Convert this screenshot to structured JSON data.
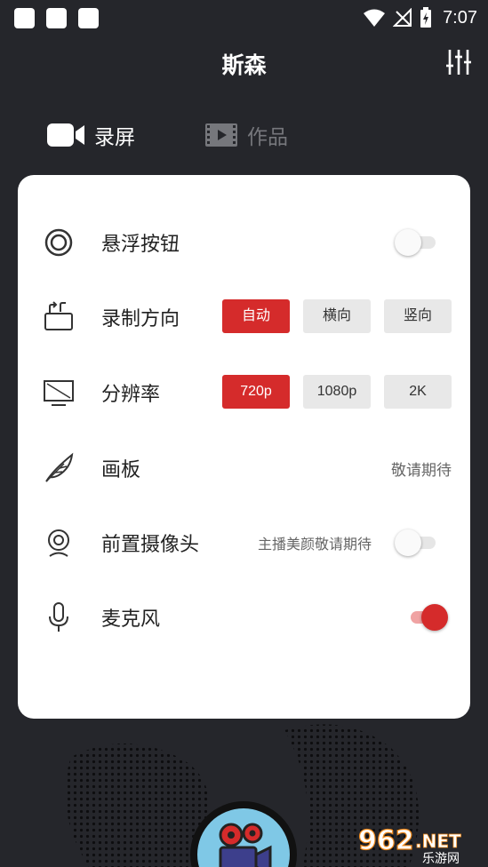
{
  "status_bar": {
    "time": "7:07",
    "icons": [
      "notification-square",
      "notification-square",
      "notification-square",
      "wifi-icon",
      "no-signal-icon",
      "battery-charging-icon"
    ]
  },
  "header": {
    "title": "斯森",
    "settings_icon": "equalizer-sliders-icon"
  },
  "tabs": [
    {
      "label": "录屏",
      "icon": "video-camera-icon",
      "active": true
    },
    {
      "label": "作品",
      "icon": "film-strip-icon",
      "active": false
    }
  ],
  "settings": {
    "floating_button": {
      "label": "悬浮按钮",
      "icon": "radio-circle-icon",
      "enabled": false
    },
    "orientation": {
      "label": "录制方向",
      "icon": "rotate-screen-icon",
      "options": [
        "自动",
        "横向",
        "竖向"
      ],
      "selected": "自动"
    },
    "resolution": {
      "label": "分辨率",
      "icon": "monitor-icon",
      "options": [
        "720p",
        "1080p",
        "2K"
      ],
      "selected": "720p"
    },
    "canvas": {
      "label": "画板",
      "icon": "feather-icon",
      "note": "敬请期待"
    },
    "front_camera": {
      "label": "前置摄像头",
      "icon": "webcam-icon",
      "note": "主播美颜敬请期待",
      "enabled": false
    },
    "microphone": {
      "label": "麦克风",
      "icon": "microphone-icon",
      "enabled": true
    }
  },
  "colors": {
    "background": "#25262b",
    "accent": "#d52b2b",
    "card": "#ffffff",
    "inactive_tab": "#76777c"
  },
  "watermark": {
    "number": "962",
    "net": ".NET",
    "subtitle": "乐游网"
  }
}
